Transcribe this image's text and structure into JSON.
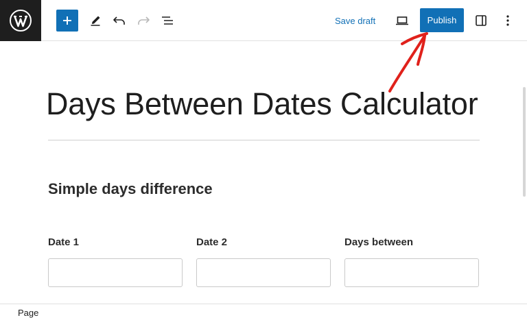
{
  "toolbar": {
    "wp_logo_icon": "wordpress-logo-icon",
    "add_block_icon": "plus-icon",
    "tools_icon": "pencil-icon",
    "undo_icon": "undo-icon",
    "redo_icon": "redo-icon",
    "document_overview_icon": "list-view-icon",
    "save_draft_label": "Save draft",
    "preview_icon": "laptop-icon",
    "publish_label": "Publish",
    "settings_icon": "sidebar-toggle-icon",
    "options_icon": "more-vertical-icon"
  },
  "post": {
    "title": "Days Between Dates Calculator"
  },
  "content": {
    "section_heading": "Simple days difference",
    "fields": [
      {
        "label": "Date 1",
        "value": ""
      },
      {
        "label": "Date 2",
        "value": ""
      },
      {
        "label": "Days between",
        "value": ""
      }
    ]
  },
  "footer": {
    "breadcrumb": "Page"
  },
  "colors": {
    "accent": "#1170b6",
    "annotation": "#e0211b",
    "logo_bg": "#1e1e1e"
  }
}
